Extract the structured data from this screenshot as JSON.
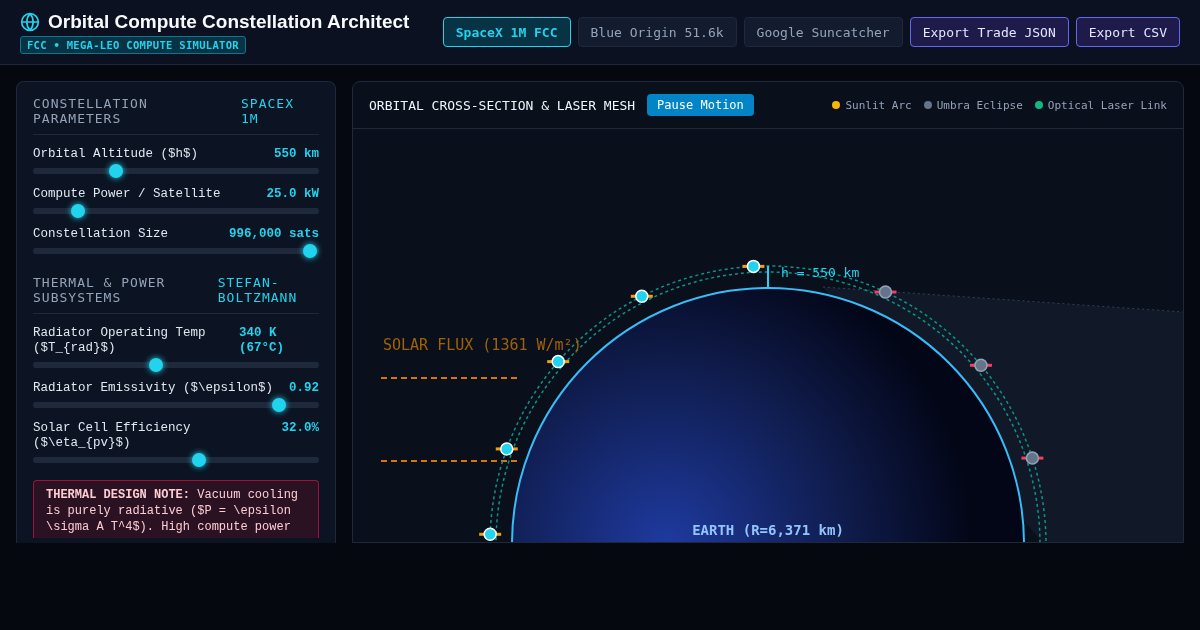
{
  "header": {
    "title": "Orbital Compute Constellation Architect",
    "subtitle": "FCC • MEGA-LEO COMPUTE SIMULATOR",
    "presets": [
      {
        "label": "SpaceX 1M FCC",
        "selected": true
      },
      {
        "label": "Blue Origin 51.6k",
        "selected": false
      },
      {
        "label": "Google Suncatcher",
        "selected": false
      }
    ],
    "exports": [
      "Export Trade JSON",
      "Export CSV"
    ]
  },
  "sections": [
    {
      "title": "CONSTELLATION PARAMETERS",
      "tag": "SPACEX 1M",
      "sliders": [
        {
          "label": "Orbital Altitude ($h$)",
          "reading": "550 km",
          "level": 0.29
        },
        {
          "label": "Compute Power / Satellite",
          "reading": "25.0 kW",
          "level": 0.157
        },
        {
          "label": "Constellation Size",
          "reading": "996,000 sats",
          "level": 0.97
        }
      ]
    },
    {
      "title": "THERMAL & POWER SUBSYSTEMS",
      "tag": "STEFAN-BOLTZMANN",
      "sliders": [
        {
          "label": "Radiator Operating Temp ($T_{rad}$)",
          "reading": "340 K (67°C)",
          "level": 0.43
        },
        {
          "label": "Radiator Emissivity ($\\epsilon$)",
          "reading": "0.92",
          "level": 0.86
        },
        {
          "label": "Solar Cell Efficiency ($\\eta_{pv}$)",
          "reading": "32.0%",
          "level": 0.58
        }
      ]
    }
  ],
  "note": "**THERMAL DESIGN NOTE:** Vacuum cooling is purely radiative ($P = \\epsilon \\sigma A T^4$). High compute power",
  "view": {
    "title": "ORBITAL CROSS-SECTION & LASER MESH",
    "button": "Pause Motion",
    "legend": [
      {
        "label": "Sunlit Arc",
        "color": "#f5b50a"
      },
      {
        "label": "Umbra Eclipse",
        "color": "#64748b"
      },
      {
        "label": "Optical Laser Link",
        "color": "#10b981"
      }
    ],
    "flux_label": "SOLAR FLUX (1361 W/m²)",
    "altitude_label": "h = 550 km",
    "earth_label": "EARTH (R=6,371 km)"
  }
}
